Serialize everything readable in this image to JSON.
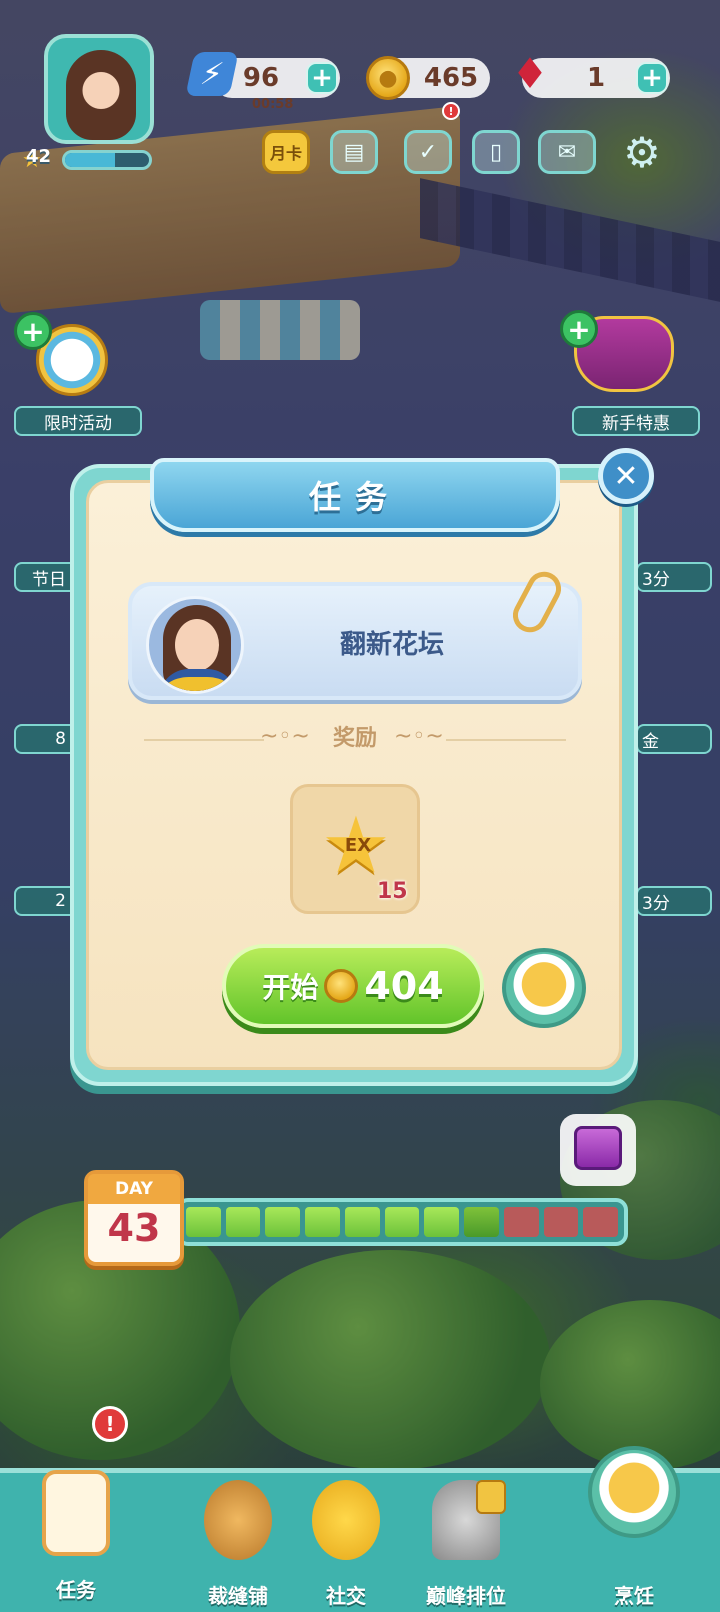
{
  "hud": {
    "player_level": "42",
    "xp_progress": 0.6,
    "energy": "96",
    "energy_timer": "00:58",
    "coins": "465",
    "gems": "1",
    "plus_symbol": "+",
    "alert_symbol": "!",
    "buttons": [
      {
        "name": "monthly-card-button",
        "label": "月卡",
        "icon": "monthly-card-icon"
      },
      {
        "name": "tasks-list-button",
        "label": "",
        "icon": "briefcase-icon"
      },
      {
        "name": "calendar-button",
        "label": "",
        "icon": "calendar-check-icon"
      },
      {
        "name": "book-button",
        "label": "",
        "icon": "book-icon"
      },
      {
        "name": "mail-button",
        "label": "",
        "icon": "envelope-icon"
      },
      {
        "name": "settings-button",
        "label": "",
        "icon": "gear-icon"
      }
    ]
  },
  "side_events": {
    "left_top": "限时活动",
    "right_top": "新手特惠",
    "left_mid": "节日",
    "right_mid_1": "3分",
    "left_mid_2": "8",
    "right_mid_2": "金",
    "left_mid_3": "2",
    "right_mid_3": "3分"
  },
  "dialog": {
    "title": "任务",
    "close_symbol": "✕",
    "task_name": "翻新花坛",
    "reward_label": "奖励",
    "reward": {
      "icon": "ex-star-icon",
      "text": "EX",
      "quantity": "15"
    },
    "start_button": {
      "label": "开始",
      "cost": "404"
    }
  },
  "day_bar": {
    "day_label": "DAY",
    "day_number": "43",
    "segments": [
      "green",
      "green",
      "green",
      "green",
      "green",
      "green",
      "green",
      "dark",
      "red",
      "red",
      "red"
    ]
  },
  "bottom_nav": {
    "alert_symbol": "!",
    "items": [
      {
        "name": "nav-tasks",
        "label": "任务",
        "icon": "clipboard-check-icon"
      },
      {
        "name": "nav-tailor",
        "label": "裁缝铺",
        "icon": "sewing-icon"
      },
      {
        "name": "nav-social",
        "label": "社交",
        "icon": "chick-icon"
      },
      {
        "name": "nav-ranking",
        "label": "巅峰排位",
        "icon": "trophy-icon"
      },
      {
        "name": "nav-cooking",
        "label": "烹饪",
        "icon": "cooking-pot-icon"
      }
    ]
  }
}
